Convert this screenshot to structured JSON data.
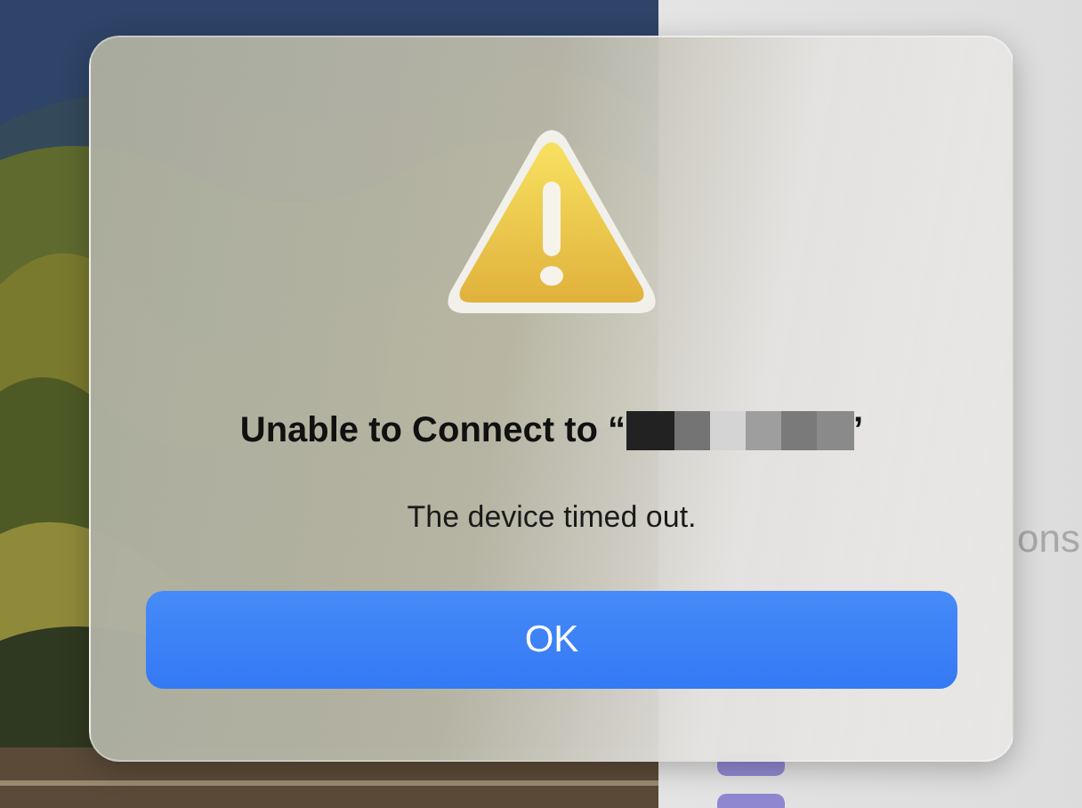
{
  "background": {
    "right_panel_text": "ons"
  },
  "dialog": {
    "title": "Unable to Connect to “",
    "title_closing": "’",
    "message": "The device timed out.",
    "buttons": [
      {
        "label": "OK",
        "default": true
      }
    ]
  }
}
